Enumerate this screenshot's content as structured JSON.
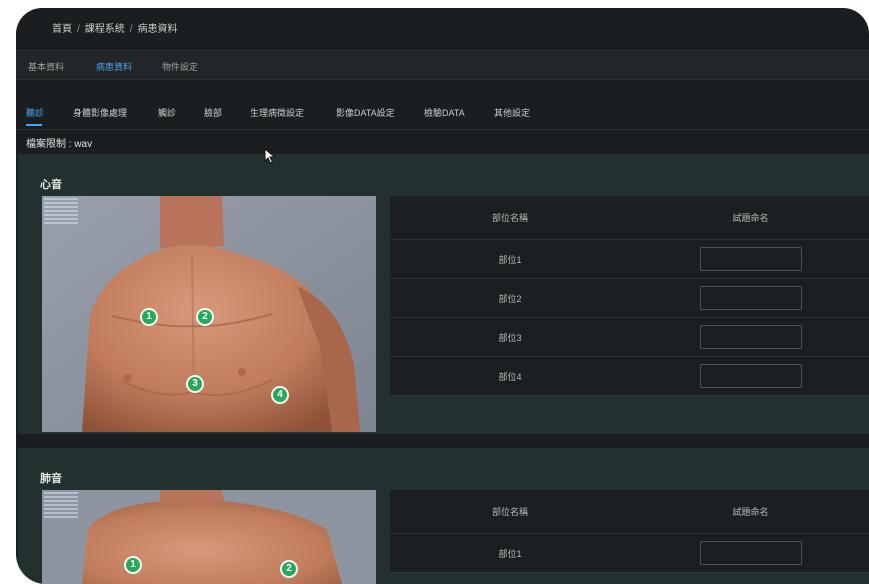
{
  "breadcrumb": {
    "items": [
      "首頁",
      "課程系統",
      "病患資料"
    ],
    "separator": "/"
  },
  "top_tabs": [
    "基本資料",
    "病患資料",
    "物件設定"
  ],
  "top_tabs_active": 1,
  "sub_tabs": [
    "聽診",
    "身體影像處理",
    "觸診",
    "臉部",
    "生理病徵設定",
    "影像DATA設定",
    "檢驗DATA",
    "其他設定"
  ],
  "sub_tabs_active": 0,
  "file_limit": "檔案限制 : wav",
  "heart": {
    "title": "心音",
    "columns": [
      "部位名稱",
      "試題命名"
    ],
    "rows": [
      "部位1",
      "部位2",
      "部位3",
      "部位4"
    ],
    "markers": [
      "1",
      "2",
      "3",
      "4"
    ]
  },
  "lung": {
    "title": "肺音",
    "columns": [
      "部位名稱",
      "試題命名"
    ],
    "rows": [
      "部位1"
    ],
    "markers": [
      "1",
      "2"
    ]
  },
  "colors": {
    "accent": "#4aa3f0",
    "marker": "#27a85a",
    "panel": "#22302f"
  }
}
